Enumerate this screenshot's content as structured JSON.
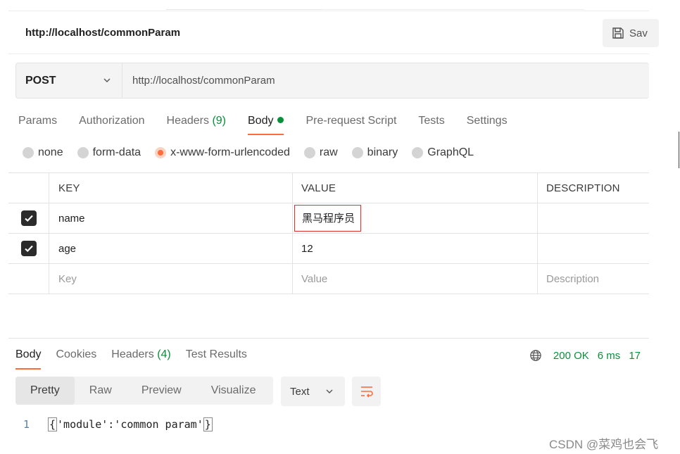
{
  "request": {
    "title": "http://localhost/commonParam",
    "save_label": "Sav",
    "method": "POST",
    "url": "http://localhost/commonParam"
  },
  "request_tabs": [
    {
      "label": "Params",
      "count": "",
      "active": false
    },
    {
      "label": "Authorization",
      "count": "",
      "active": false
    },
    {
      "label": "Headers ",
      "count": "(9)",
      "active": false
    },
    {
      "label": "Body",
      "count": "",
      "active": true,
      "dot": true
    },
    {
      "label": "Pre-request Script",
      "count": "",
      "active": false
    },
    {
      "label": "Tests",
      "count": "",
      "active": false
    },
    {
      "label": "Settings",
      "count": "",
      "active": false
    }
  ],
  "body_types": [
    {
      "label": "none",
      "checked": false
    },
    {
      "label": "form-data",
      "checked": false
    },
    {
      "label": "x-www-form-urlencoded",
      "checked": true
    },
    {
      "label": "raw",
      "checked": false
    },
    {
      "label": "binary",
      "checked": false
    },
    {
      "label": "GraphQL",
      "checked": false
    }
  ],
  "params_table": {
    "headers": {
      "key": "KEY",
      "value": "VALUE",
      "description": "DESCRIPTION"
    },
    "rows": [
      {
        "checked": true,
        "key": "name",
        "value": "黑马程序员",
        "description": ""
      },
      {
        "checked": true,
        "key": "age",
        "value": "12",
        "description": ""
      }
    ],
    "placeholder": {
      "key": "Key",
      "value": "Value",
      "description": "Description"
    }
  },
  "response_tabs": [
    {
      "label": "Body",
      "count": "",
      "active": true
    },
    {
      "label": "Cookies",
      "count": "",
      "active": false
    },
    {
      "label": "Headers ",
      "count": "(4)",
      "active": false
    },
    {
      "label": "Test Results",
      "count": "",
      "active": false
    }
  ],
  "response_status": {
    "status": "200 OK",
    "time": "6 ms",
    "size": "17"
  },
  "view_modes": [
    {
      "label": "Pretty",
      "active": true
    },
    {
      "label": "Raw",
      "active": false
    },
    {
      "label": "Preview",
      "active": false
    },
    {
      "label": "Visualize",
      "active": false
    }
  ],
  "format": "Text",
  "code": {
    "line_number": "1",
    "open_brace": "{",
    "content": "'module':'common param'",
    "close_brace": "}"
  },
  "watermark": "CSDN @菜鸡也会飞",
  "colors": {
    "accent": "#ff6c37",
    "success": "#0a8f3a",
    "highlight_border": "#e0302d"
  }
}
